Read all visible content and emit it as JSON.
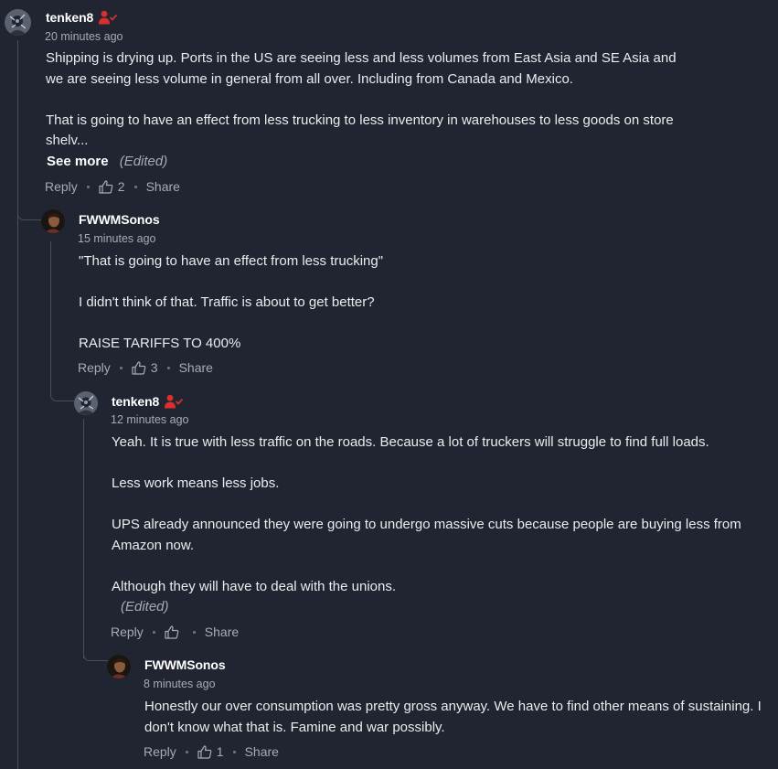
{
  "comments": [
    {
      "author": "tenken8",
      "timestamp": "20 minutes ago",
      "paragraphs": [
        "Shipping is drying up. Ports in the US are seeing less and less volumes from East Asia and SE Asia and we are seeing less volume in general from all over. Including from Canada and Mexico.",
        "That is going to have an effect from less trucking to less inventory in warehouses to less goods on store shelv..."
      ],
      "see_more": "See more",
      "edited": "(Edited)",
      "reply": "Reply",
      "likes": "2",
      "share": "Share",
      "avatar": "tenken8-avatar",
      "badge_icon": "user-check-icon"
    },
    {
      "author": "FWWMSonos",
      "timestamp": "15 minutes ago",
      "paragraphs": [
        "\"That is going to have an effect from less trucking\"",
        "I didn't think of that.  Traffic is about to get better?",
        "RAISE TARIFFS TO 400%"
      ],
      "reply": "Reply",
      "likes": "3",
      "share": "Share",
      "avatar": "fwwmsonos-avatar"
    },
    {
      "author": "tenken8",
      "timestamp": "12 minutes ago",
      "paragraphs": [
        "Yeah. It is true with less traffic on the roads. Because a lot of truckers will struggle to find full loads.",
        "Less work means less jobs.",
        "UPS already announced they were going to undergo massive cuts because people are buying less from Amazon now.",
        "Although they will have to deal with the unions."
      ],
      "edited": "(Edited)",
      "reply": "Reply",
      "likes": "",
      "share": "Share",
      "avatar": "tenken8-avatar",
      "badge_icon": "user-check-icon"
    },
    {
      "author": "FWWMSonos",
      "timestamp": "8 minutes ago",
      "paragraphs": [
        "Honestly our over consumption was pretty gross anyway.  We have to find other means of sustaining.  I don't know what that is.  Famine and war possibly."
      ],
      "reply": "Reply",
      "likes": "1",
      "share": "Share",
      "avatar": "fwwmsonos-avatar"
    }
  ],
  "colors": {
    "background": "#212431",
    "badge_red": "#d92f2f",
    "text": "#ececef",
    "muted": "#a9abb3"
  }
}
